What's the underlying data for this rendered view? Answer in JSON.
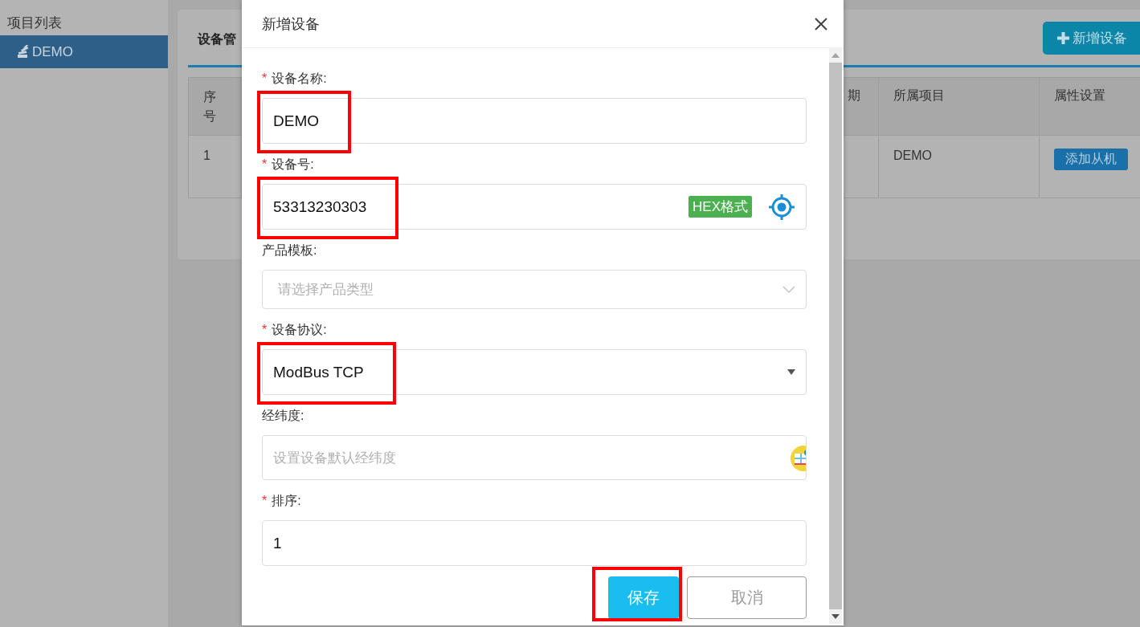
{
  "sidebar": {
    "title": "项目列表",
    "items": [
      {
        "label": "DEMO",
        "selected": true
      }
    ]
  },
  "panel": {
    "title": "设备管",
    "add_button": "新增设备",
    "table": {
      "columns": [
        "序号",
        "期",
        "所属项目",
        "属性设置"
      ],
      "rows": [
        {
          "index": "1",
          "project": "DEMO",
          "action": "添加从机"
        }
      ]
    }
  },
  "dialog": {
    "title": "新增设备",
    "fields": [
      {
        "kind": "text",
        "required_mark": "*",
        "label": "设备名称:",
        "value": "DEMO",
        "highlighted": true
      },
      {
        "kind": "device",
        "required_mark": "*",
        "label": "设备号:",
        "value": "53313230303",
        "badge": "HEX格式",
        "highlighted": true
      },
      {
        "kind": "select",
        "label": "产品模板:",
        "placeholder": "请选择产品类型",
        "highlighted": false
      },
      {
        "kind": "dropdown",
        "required_mark": "*",
        "label": "设备协议:",
        "value": "ModBus TCP",
        "highlighted": true
      },
      {
        "kind": "location",
        "label": "经纬度:",
        "placeholder": "设置设备默认经纬度",
        "highlighted": false
      },
      {
        "kind": "text",
        "required_mark": "*",
        "label": "排序:",
        "value": "1",
        "highlighted": false
      }
    ],
    "buttons": [
      {
        "kind": "primary",
        "label": "保存",
        "highlighted": true
      },
      {
        "kind": "secondary",
        "label": "取消",
        "highlighted": false
      }
    ]
  }
}
